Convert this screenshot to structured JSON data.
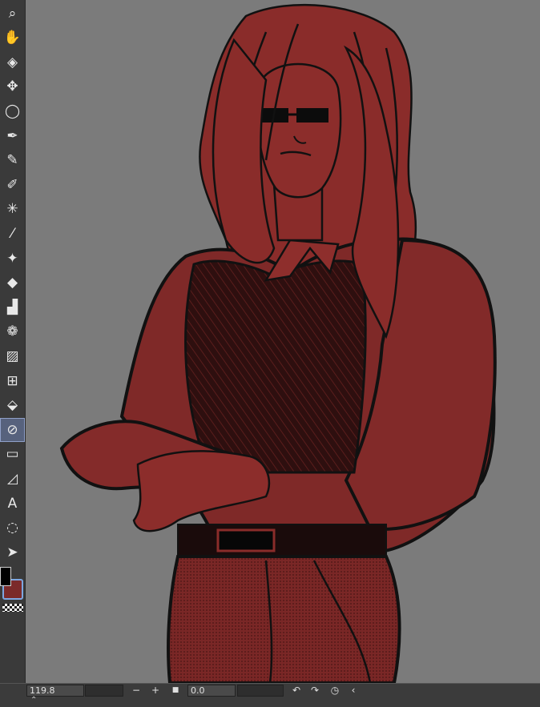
{
  "statusbar": {
    "zoom": "119.8",
    "rotation": "0.0",
    "zoom_out": "−",
    "zoom_in": "+",
    "stop": "■",
    "rotate_left": "↶",
    "rotate_right": "↷",
    "reset": "◷",
    "collapse": "‹"
  },
  "bottombar": {
    "expand": "⌃"
  },
  "toolbar": {
    "tools": [
      {
        "name": "zoom-tool",
        "icon": "magnifier-icon",
        "glyph": "⌕"
      },
      {
        "name": "hand-tool",
        "icon": "hand-icon",
        "glyph": "✋"
      },
      {
        "name": "layer-move-tool",
        "icon": "layers-icon",
        "glyph": "◈"
      },
      {
        "name": "move-tool",
        "icon": "move-arrows-icon",
        "glyph": "✥"
      },
      {
        "name": "lasso-select-tool",
        "icon": "lasso-icon",
        "glyph": "◯"
      },
      {
        "name": "pen-tool",
        "icon": "pen-icon",
        "glyph": "✒"
      },
      {
        "name": "pencil-tool",
        "icon": "pencil-icon",
        "glyph": "✎"
      },
      {
        "name": "brush-tool",
        "icon": "brush-icon",
        "glyph": "✐"
      },
      {
        "name": "sparkle-tool",
        "icon": "sparkle-icon",
        "glyph": "✳"
      },
      {
        "name": "eyedropper-tool",
        "icon": "eyedropper-icon",
        "glyph": "⁄"
      },
      {
        "name": "decoration-tool",
        "icon": "stars-icon",
        "glyph": "✦"
      },
      {
        "name": "eraser-tool",
        "icon": "eraser-icon",
        "glyph": "◆"
      },
      {
        "name": "airbrush-tool",
        "icon": "airbrush-icon",
        "glyph": "▟"
      },
      {
        "name": "blend-tool",
        "icon": "droplets-icon",
        "glyph": "❁"
      },
      {
        "name": "gradient-tool",
        "icon": "gradient-icon",
        "glyph": "▨"
      },
      {
        "name": "frame-tool",
        "icon": "frame-icon",
        "glyph": "⊞"
      },
      {
        "name": "fill-tool",
        "icon": "paint-bucket-icon",
        "glyph": "⬙"
      },
      {
        "name": "lasso-fill-tool",
        "icon": "lasso-fill-icon",
        "glyph": "⊘"
      },
      {
        "name": "figure-tool",
        "icon": "rectangle-icon",
        "glyph": "▭"
      },
      {
        "name": "ruler-tool",
        "icon": "ruler-icon",
        "glyph": "◿"
      },
      {
        "name": "text-tool",
        "icon": "text-icon",
        "glyph": "A"
      },
      {
        "name": "balloon-tool",
        "icon": "speech-balloon-icon",
        "glyph": "◌"
      },
      {
        "name": "object-select-tool",
        "icon": "arrow-cursor-icon",
        "glyph": "➤"
      }
    ]
  },
  "colors": {
    "main": "#000000",
    "sub": "#7b2a2a",
    "canvas_bg": "#7b7b7b",
    "hair": "#8a2c2a",
    "ink": "#111111"
  }
}
